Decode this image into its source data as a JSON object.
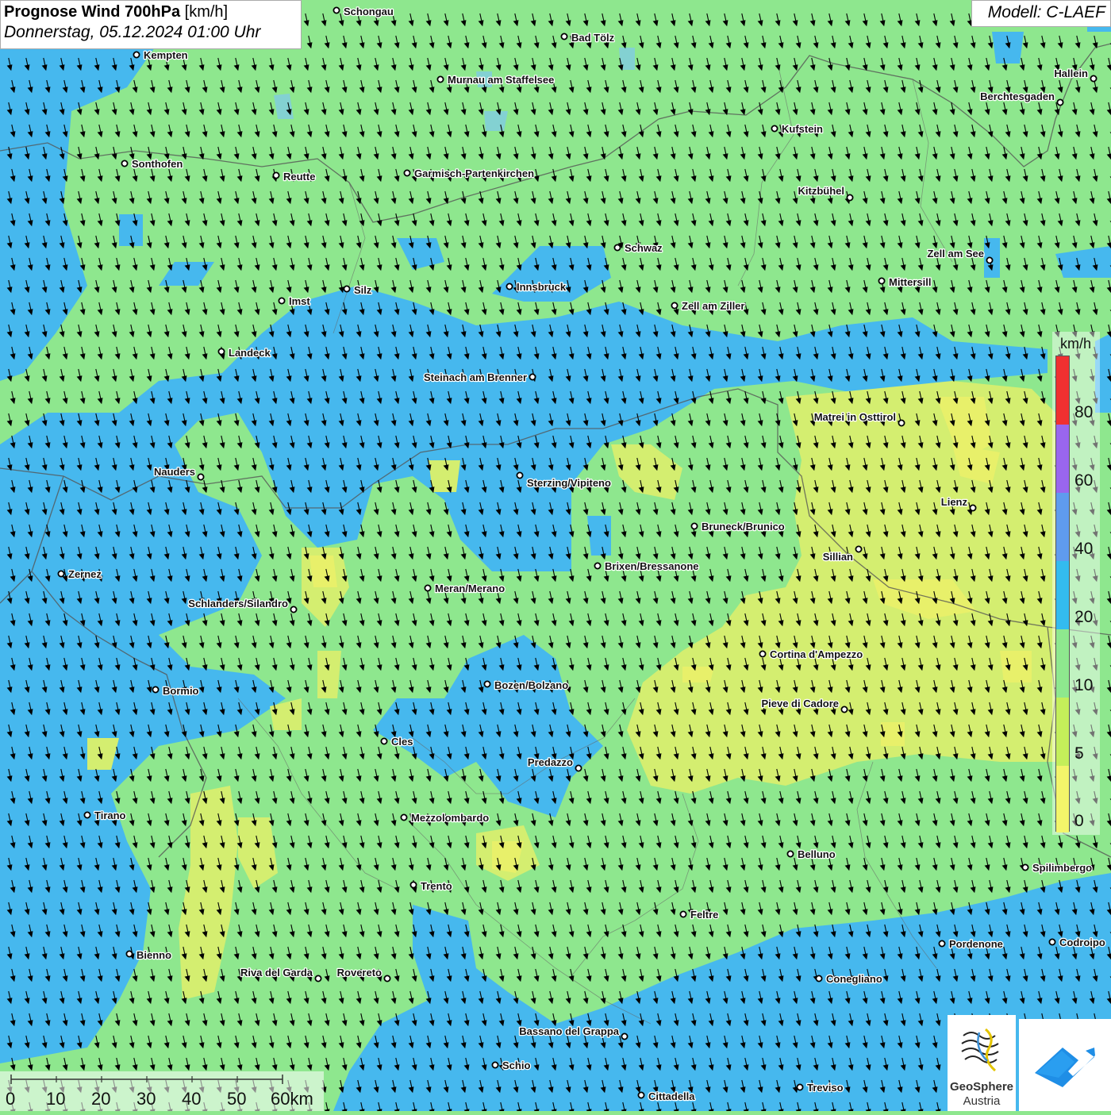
{
  "title": {
    "main_bold": "Prognose Wind 700hPa",
    "unit": "[km/h]",
    "datetime": "Donnerstag, 05.12.2024 01:00 Uhr"
  },
  "model_label": "Modell: C-LAEF",
  "wind_direction": "from north-northwest (arrows point south, slightly east)",
  "legend": {
    "unit": "km/h",
    "ticks": [
      "80",
      "60",
      "40",
      "20",
      "10",
      "5",
      "0"
    ],
    "colors": [
      "#f03030",
      "#9966ee",
      "#5f9bee",
      "#33bbef",
      "#8ee88e",
      "#c4ef5a",
      "#f3f56a"
    ]
  },
  "colors": {
    "light_green": "#8ee78e",
    "blue": "#46b8ee",
    "yellow_green": "#d6ee72",
    "city_ring": "#000000"
  },
  "cities": [
    {
      "name": "Schongau"
    },
    {
      "name": "Bad Tölz"
    },
    {
      "name": "Kempten"
    },
    {
      "name": "Murnau am Staffelsee"
    },
    {
      "name": "Hallein"
    },
    {
      "name": "Berchtesgaden"
    },
    {
      "name": "Kufstein"
    },
    {
      "name": "Sonthofen"
    },
    {
      "name": "Reutte"
    },
    {
      "name": "Garmisch-Partenkirchen"
    },
    {
      "name": "Kitzbühel"
    },
    {
      "name": "Schwaz"
    },
    {
      "name": "Zell am See"
    },
    {
      "name": "Mittersill"
    },
    {
      "name": "Innsbruck"
    },
    {
      "name": "Silz"
    },
    {
      "name": "Imst"
    },
    {
      "name": "Zell am Ziller"
    },
    {
      "name": "Landeck"
    },
    {
      "name": "Steinach am Brenner"
    },
    {
      "name": "Matrei in Osttirol"
    },
    {
      "name": "Nauders"
    },
    {
      "name": "Sterzing/Vipiteno"
    },
    {
      "name": "Lienz"
    },
    {
      "name": "Bruneck/Brunico"
    },
    {
      "name": "Sillian"
    },
    {
      "name": "Brixen/Bressanone"
    },
    {
      "name": "Zernez"
    },
    {
      "name": "Meran/Merano"
    },
    {
      "name": "Schlanders/Silandro"
    },
    {
      "name": "Cortina d'Ampezzo"
    },
    {
      "name": "Bormio"
    },
    {
      "name": "Bozen/Bolzano"
    },
    {
      "name": "Pieve di Cadore"
    },
    {
      "name": "Cles"
    },
    {
      "name": "Predazzo"
    },
    {
      "name": "Tirano"
    },
    {
      "name": "Mezzolombardo"
    },
    {
      "name": "Belluno"
    },
    {
      "name": "Spilimbergo"
    },
    {
      "name": "Trento"
    },
    {
      "name": "Feltre"
    },
    {
      "name": "Pordenone"
    },
    {
      "name": "Codroipo"
    },
    {
      "name": "Bienno"
    },
    {
      "name": "Riva del Garda"
    },
    {
      "name": "Rovereto"
    },
    {
      "name": "Conegliano"
    },
    {
      "name": "Bassano del Grappa"
    },
    {
      "name": "Schio"
    },
    {
      "name": "Treviso"
    },
    {
      "name": "Cittadella"
    }
  ],
  "scale_bar": {
    "labels": [
      "0",
      "10",
      "20",
      "30",
      "40",
      "50",
      "60km"
    ]
  },
  "logos": {
    "geosphere_line1": "GeoSphere",
    "geosphere_line2": "Austria"
  }
}
